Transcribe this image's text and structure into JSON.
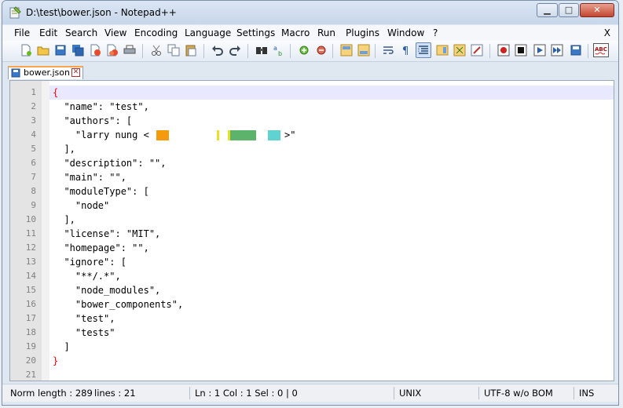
{
  "window": {
    "title": "D:\\test\\bower.json - Notepad++",
    "minimize_glyph": "▁",
    "maximize_glyph": "□",
    "close_glyph": "✕"
  },
  "menu": {
    "items": [
      "File",
      "Edit",
      "Search",
      "View",
      "Encoding",
      "Language",
      "Settings",
      "Macro",
      "Run",
      "Plugins",
      "Window",
      "?"
    ],
    "close_label": "X"
  },
  "toolbar": {
    "icons": [
      "new-file-icon",
      "open-file-icon",
      "save-icon",
      "save-all-icon",
      "close-icon",
      "close-all-icon",
      "print-icon",
      "cut-icon",
      "copy-icon",
      "paste-icon",
      "undo-icon",
      "redo-icon",
      "find-icon",
      "replace-icon",
      "zoom-in-icon",
      "zoom-out-icon",
      "sync-vertical-icon",
      "sync-horizontal-icon",
      "word-wrap-icon",
      "show-all-chars-icon",
      "indent-guide-icon",
      "doc-map-icon",
      "function-list-icon",
      "folder-workspace-icon",
      "record-macro-icon",
      "stop-recording-icon",
      "play-macro-icon",
      "run-macro-multiple-icon",
      "save-macro-icon",
      "spell-check-icon"
    ],
    "selected": "indent-guide-icon"
  },
  "tab": {
    "label": "bower.json",
    "close_glyph": "✕"
  },
  "editor": {
    "lines": [
      {
        "n": "1",
        "text": "{",
        "brace": true
      },
      {
        "n": "2",
        "text": "  \"name\": \"test\","
      },
      {
        "n": "3",
        "text": "  \"authors\": ["
      },
      {
        "n": "4",
        "text": "    \"larry nung <",
        "redacted": true,
        "suffix": ">\""
      },
      {
        "n": "5",
        "text": "  ],"
      },
      {
        "n": "6",
        "text": "  \"description\": \"\","
      },
      {
        "n": "7",
        "text": "  \"main\": \"\","
      },
      {
        "n": "8",
        "text": "  \"moduleType\": ["
      },
      {
        "n": "9",
        "text": "    \"node\""
      },
      {
        "n": "10",
        "text": "  ],"
      },
      {
        "n": "11",
        "text": "  \"license\": \"MIT\","
      },
      {
        "n": "12",
        "text": "  \"homepage\": \"\","
      },
      {
        "n": "13",
        "text": "  \"ignore\": ["
      },
      {
        "n": "14",
        "text": "    \"**/.*\","
      },
      {
        "n": "15",
        "text": "    \"node_modules\","
      },
      {
        "n": "16",
        "text": "    \"bower_components\","
      },
      {
        "n": "17",
        "text": "    \"test\","
      },
      {
        "n": "18",
        "text": "    \"tests\""
      },
      {
        "n": "19",
        "text": "  ]"
      },
      {
        "n": "20",
        "text": "}",
        "brace": true
      },
      {
        "n": "21",
        "text": ""
      }
    ],
    "current_line": "1",
    "redaction_colors": [
      "#f39a0d",
      "#e8e020",
      "#5cb36b",
      "#5fd3cf"
    ]
  },
  "status": {
    "type": "Norm",
    "length": "length : 289",
    "lines": "lines : 21",
    "position": "Ln : 1    Col : 1    Sel : 0 | 0",
    "eol": "UNIX",
    "encoding": "UTF-8 w/o BOM",
    "mode": "INS"
  }
}
